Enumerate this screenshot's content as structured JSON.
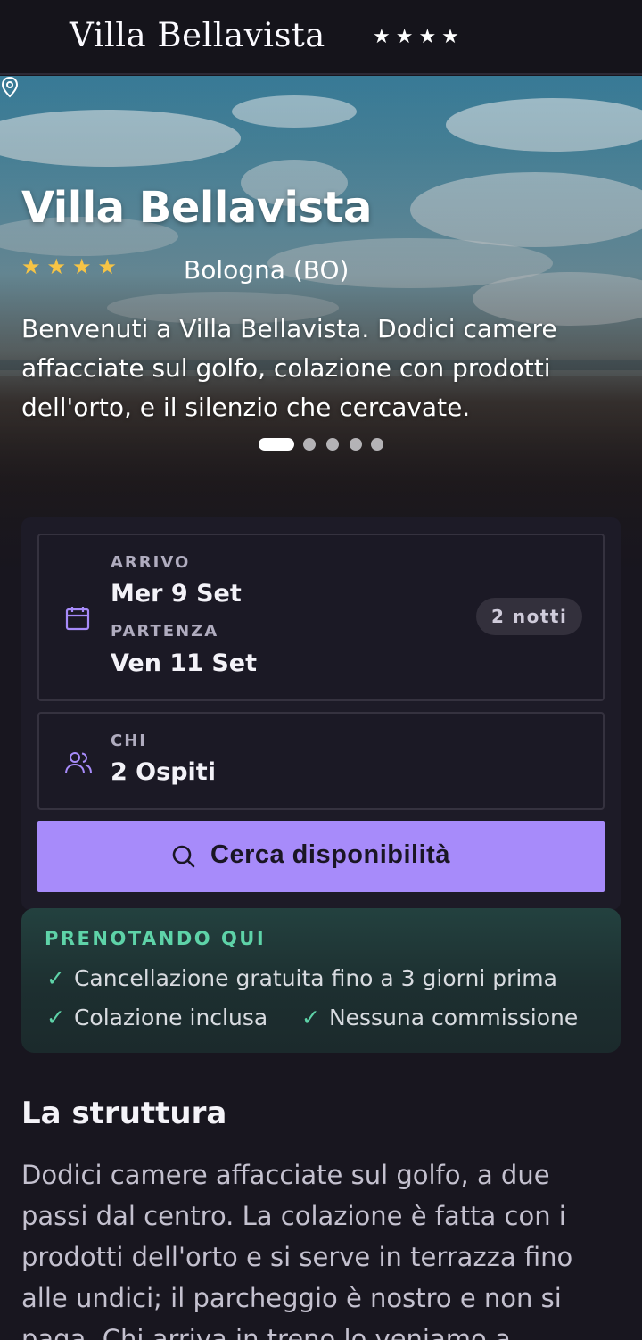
{
  "header": {
    "brand": "Villa Bellavista",
    "stars": "★★★★"
  },
  "hero": {
    "title": "Villa Bellavista",
    "stars": "★★★★",
    "location": "Bologna (BO)",
    "description": "Benvenuti a Villa Bellavista. Dodici camere affacciate sul golfo, colazione con prodotti dell'orto, e il silenzio che cercavate.",
    "carousel": {
      "slides": 5,
      "active": 1
    }
  },
  "booking": {
    "arrival_label": "ARRIVO",
    "arrival_value": "Mer 9 Set",
    "departure_label": "PARTENZA",
    "departure_value": "Ven 11 Set",
    "nights": "2 notti",
    "guests_label": "CHI",
    "guests_value": "2 Ospiti",
    "search_label": "Cerca disponibilità"
  },
  "perks": {
    "title": "PRENOTANDO QUI",
    "check": "✓",
    "items": [
      "Cancellazione gratuita fino a 3 giorni prima",
      "Colazione inclusa",
      "Nessuna commissione"
    ]
  },
  "about": {
    "title": "La struttura",
    "body": "Dodici camere affacciate sul golfo, a due passi dal centro. La colazione è fatta con i prodotti dell'orto e si serve in terrazza fino alle undici; il parcheggio è nostro e non si paga. Chi arriva in treno lo veniamo a"
  },
  "colors": {
    "accent": "#a78bfa",
    "background": "#18161f",
    "perk_green": "#5ed3a8",
    "star_gold": "#f6c445"
  },
  "icons": [
    "map-pin-icon",
    "calendar-icon",
    "users-icon",
    "search-icon",
    "check-icon"
  ]
}
